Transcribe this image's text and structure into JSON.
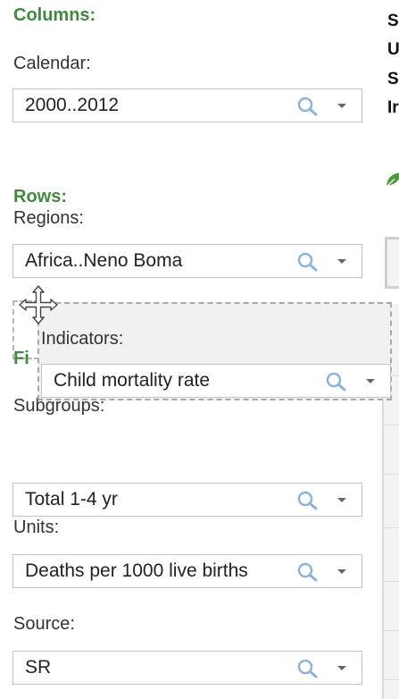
{
  "columns": {
    "heading": "Columns:",
    "calendar": {
      "label": "Calendar:",
      "value": "2000..2012"
    }
  },
  "rows": {
    "heading": "Rows:",
    "regions": {
      "label": "Regions:",
      "value": "Africa..Neno Boma"
    }
  },
  "dragging_item": {
    "label": "Indicators:",
    "value": "Child mortality rate"
  },
  "filters": {
    "heading_visible_fragment": "Fi",
    "subgroups": {
      "label": "Subgroups:",
      "value": "Total 1-4 yr"
    },
    "units": {
      "label": "Units:",
      "value": "Deaths per 1000 live births"
    },
    "source": {
      "label": "Source:",
      "value": "SR"
    }
  },
  "right_panel_fragments": [
    "S",
    "U",
    "S",
    "Ir"
  ],
  "colors": {
    "section_heading": "#3f8a3f",
    "border": "#c4c4c4",
    "search_icon": "#8db3d9",
    "leaf_icon": "#4a9b3a"
  },
  "icons": {
    "search": "search-icon",
    "dropdown": "chevron-down-icon",
    "move": "move-icon",
    "leaf": "leaf-icon"
  }
}
